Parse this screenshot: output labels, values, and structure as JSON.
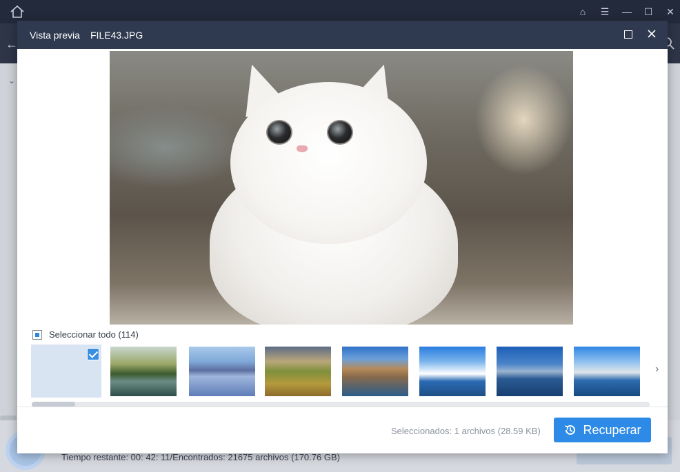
{
  "app": {
    "status_text": "Tiempo restante: 00: 42: 11/Encontrados: 21675 archivos (170.76 GB)"
  },
  "modal": {
    "title": "Vista previa",
    "filename": "FILE43.JPG",
    "select_all_label": "Seleccionar todo (114)",
    "selected_info": "Seleccionados: 1 archivos (28.59 KB)",
    "recover_label": "Recuperar"
  },
  "thumbnails": [
    {
      "selected": true
    },
    {
      "selected": false
    },
    {
      "selected": false
    },
    {
      "selected": false
    },
    {
      "selected": false
    },
    {
      "selected": false
    },
    {
      "selected": false
    },
    {
      "selected": false
    }
  ],
  "colors": {
    "accent": "#2d8ae6",
    "modal_header": "#2f3a50",
    "app_titlebar": "#232a3b"
  }
}
